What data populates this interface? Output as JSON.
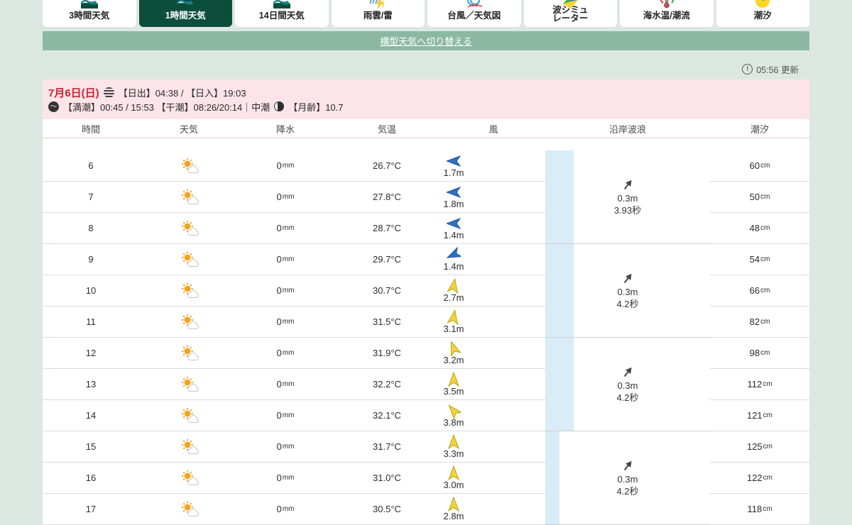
{
  "colors": {
    "accent_green": "#0d4e3b",
    "banner_green": "#8cb8a3",
    "pink_header": "#fce4e8",
    "date_red": "#cc2130",
    "blue_band": "#d9ecf7",
    "wind_blue": "#2e6fc2",
    "wind_yellow": "#f2d43c",
    "sun_orange": "#f59311"
  },
  "icons": {
    "wave_glyph": "〜",
    "alert_glyph": "!"
  },
  "tabs": [
    {
      "name": "tab-3hour-weather",
      "label": "3時間天気",
      "icon": "beach",
      "selected": false
    },
    {
      "name": "tab-1hour-weather",
      "label": "1時間天気",
      "icon": "beach",
      "selected": true
    },
    {
      "name": "tab-14day-weather",
      "label": "14日間天気",
      "icon": "beach",
      "selected": false
    },
    {
      "name": "tab-raincloud-thunder",
      "label": "雨雲/雷",
      "icon": "thunder",
      "selected": false
    },
    {
      "name": "tab-typhoon-chart",
      "label": "台風／天気図",
      "icon": "typhoon",
      "selected": false
    },
    {
      "name": "tab-wave-simulator",
      "label": "波シミュ",
      "label2": "レーター",
      "icon": "wavesim",
      "selected": false
    },
    {
      "name": "tab-seatemp-current",
      "label": "海水温/潮流",
      "icon": "seatemp",
      "selected": false
    },
    {
      "name": "tab-tide",
      "label": "潮汐",
      "icon": "tide",
      "selected": false
    }
  ],
  "banner": {
    "label": "横型天気へ切り替える"
  },
  "updated": {
    "time": "05:56",
    "suffix": "更新"
  },
  "day_header": {
    "date": "7月6日(日)",
    "sun_info": "【日出】04:38 / 【日入】19:03",
    "tide_info": "【満潮】00:45 / 15:53 【干潮】08:26/20:14｜中潮",
    "moon_label": "【月齢】",
    "moon_age": "10.7"
  },
  "table": {
    "headers": [
      "時間",
      "天気",
      "降水",
      "気温",
      "風",
      "沿岸波浪",
      "潮汐"
    ],
    "units": {
      "precip": "mm",
      "temp": "°C",
      "wind": "m",
      "tide": "cm"
    },
    "rows": [
      {
        "hour": "6",
        "precip": "0",
        "temp": "26.7",
        "wind_speed": "1.7",
        "wind_dir": -90,
        "wind_color": "blue",
        "tide": "60"
      },
      {
        "hour": "7",
        "precip": "0",
        "temp": "27.8",
        "wind_speed": "1.8",
        "wind_dir": -90,
        "wind_color": "blue",
        "tide": "50"
      },
      {
        "hour": "8",
        "precip": "0",
        "temp": "28.7",
        "wind_speed": "1.4",
        "wind_dir": -90,
        "wind_color": "blue",
        "tide": "48"
      },
      {
        "hour": "9",
        "precip": "0",
        "temp": "29.7",
        "wind_speed": "1.4",
        "wind_dir": -115,
        "wind_color": "blue",
        "tide": "54"
      },
      {
        "hour": "10",
        "precip": "0",
        "temp": "30.7",
        "wind_speed": "2.7",
        "wind_dir": 10,
        "wind_color": "yellow",
        "tide": "66"
      },
      {
        "hour": "11",
        "precip": "0",
        "temp": "31.5",
        "wind_speed": "3.1",
        "wind_dir": 10,
        "wind_color": "yellow",
        "tide": "82"
      },
      {
        "hour": "12",
        "precip": "0",
        "temp": "31.9",
        "wind_speed": "3.2",
        "wind_dir": -20,
        "wind_color": "yellow",
        "tide": "98"
      },
      {
        "hour": "13",
        "precip": "0",
        "temp": "32.2",
        "wind_speed": "3.5",
        "wind_dir": 0,
        "wind_color": "yellow",
        "tide": "112"
      },
      {
        "hour": "14",
        "precip": "0",
        "temp": "32.1",
        "wind_speed": "3.8",
        "wind_dir": -40,
        "wind_color": "yellow",
        "tide": "121"
      },
      {
        "hour": "15",
        "precip": "0",
        "temp": "31.7",
        "wind_speed": "3.3",
        "wind_dir": 0,
        "wind_color": "yellow",
        "tide": "125"
      },
      {
        "hour": "16",
        "precip": "0",
        "temp": "31.0",
        "wind_speed": "3.0",
        "wind_dir": 0,
        "wind_color": "yellow",
        "tide": "122"
      },
      {
        "hour": "17",
        "precip": "0",
        "temp": "30.5",
        "wind_speed": "2.8",
        "wind_dir": 0,
        "wind_color": "yellow",
        "tide": "118"
      }
    ],
    "wave_groups": [
      {
        "height": "0.3m",
        "period": "3.93秒"
      },
      {
        "height": "0.3m",
        "period": "4.2秒"
      },
      {
        "height": "0.3m",
        "period": "4.2秒"
      },
      {
        "height": "0.3m",
        "period": "4.2秒"
      }
    ]
  }
}
